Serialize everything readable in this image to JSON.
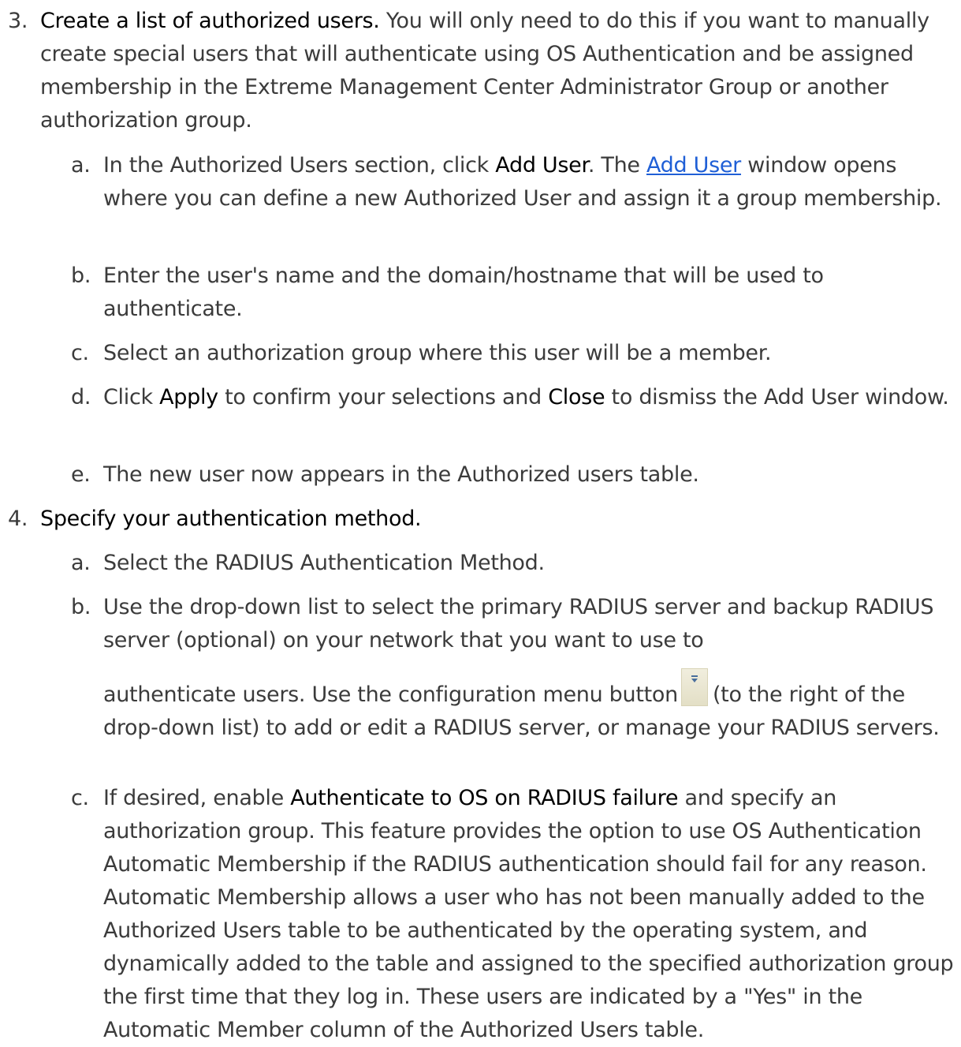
{
  "step3": {
    "number": "3.",
    "title": "Create a list of authorized users.",
    "body": " You will only need to do this if you want to manually create special users that will authenticate using OS Authentication and be assigned membership in the Extreme Management Center Administrator Group or another authorization group.",
    "items": [
      {
        "letter": "a.",
        "pre": "In the Authorized Users section, click ",
        "bold": "Add User",
        "mid": ". The ",
        "link": "Add User",
        "post": " window opens where you can define a new Authorized User and assign it a group membership."
      },
      {
        "letter": "b.",
        "text": "Enter the user's name and the domain/hostname that will be used to authenticate."
      },
      {
        "letter": "c.",
        "text": "Select an authorization group where this user will be a member."
      },
      {
        "letter": "d.",
        "pre": "Click ",
        "bold1": "Apply",
        "mid": " to confirm your selections and ",
        "bold2": "Close",
        "post": " to dismiss the Add User window."
      },
      {
        "letter": "e.",
        "text": "The new user now appears in the Authorized users table."
      }
    ]
  },
  "step4": {
    "number": "4.",
    "title": "Specify your authentication method.",
    "items": [
      {
        "letter": "a.",
        "text": "Select the RADIUS Authentication Method."
      },
      {
        "letter": "b.",
        "pre": "Use the drop-down list to select the primary RADIUS server  and backup RADIUS server (optional) on your network that you want to use to",
        "line3": "authenticate users. Use the configuration menu button",
        "post": "(to the right of the drop-down list) to add or edit a RADIUS server, or manage your RADIUS servers.",
        "icon": "configuration-menu-icon"
      },
      {
        "letter": "c.",
        "pre": "If desired, enable ",
        "bold": "Authenticate to OS on RADIUS failure",
        "post": " and specify an authorization group. This feature provides the option to use OS Authentication Automatic Membership if the RADIUS authentication should fail for any reason. Automatic Membership allows a user who has not been manually added to the Authorized Users table to be authenticated by the operating system, and dynamically added to the table and assigned to the specified authorization group the first time that they log in. These users are indicated by a \"Yes\" in the Automatic Member column of the Authorized Users table."
      }
    ]
  }
}
